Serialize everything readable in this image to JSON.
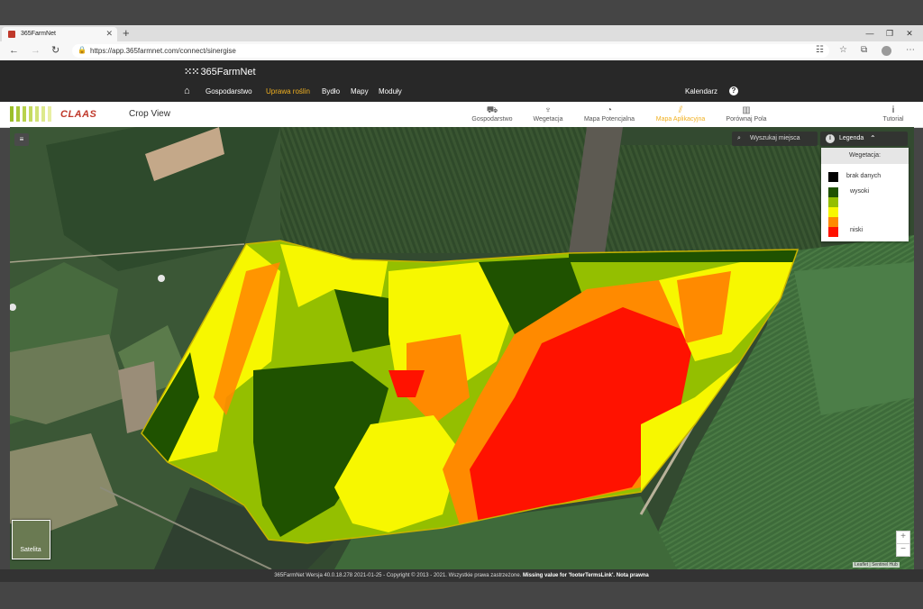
{
  "browser": {
    "tab_title": "365FarmNet",
    "url": "https://app.365farmnet.com/connect/sinergise"
  },
  "app": {
    "logo": "365FarmNet",
    "menu": [
      "Gospodarstwo",
      "Uprawa roślin",
      "Bydło",
      "Mapy",
      "Moduły"
    ],
    "active_menu": "Uprawa roślin",
    "calendar": "Kalendarz"
  },
  "toolbar": {
    "brand": "CLAAS",
    "view_title": "Crop View",
    "buttons": [
      {
        "label": "Gospodarstwo",
        "icon": "tractor-icon"
      },
      {
        "label": "Wegetacja",
        "icon": "plant-icon"
      },
      {
        "label": "Mapa Potencjalna",
        "icon": "gauge-icon"
      },
      {
        "label": "Mapa Aplikacyjna",
        "icon": "spray-icon"
      },
      {
        "label": "Porównaj Pola",
        "icon": "bar-chart-icon"
      }
    ],
    "active_button": "Mapa Aplikacyjna",
    "tutorial": "Tutorial"
  },
  "map": {
    "search_placeholder": "Wyszukaj miejsca",
    "legend_button": "Legenda",
    "legend": {
      "title": "Wegetacja:",
      "items": [
        {
          "label": "brak danych",
          "color": "#000000"
        },
        {
          "label": "wysoki",
          "color": "#1f5200"
        },
        {
          "label": "",
          "color": "#94bf00"
        },
        {
          "label": "",
          "color": "#f7f700"
        },
        {
          "label": "",
          "color": "#ff8a00"
        },
        {
          "label": "niski",
          "color": "#ff1200"
        }
      ]
    },
    "basemap_label": "Satelita",
    "zoom_in": "+",
    "zoom_out": "−",
    "attribution": "Leaflet | Sentinel Hub"
  },
  "footer": {
    "text": "365FarmNet Wersja 40.0.18.278 2021-01-25 - Copyright © 2013 - 2021. Wszystkie prawa zastrzeżone.",
    "missing": "Missing value for 'footerTermsLink'.",
    "legal": "Nota prawna"
  }
}
